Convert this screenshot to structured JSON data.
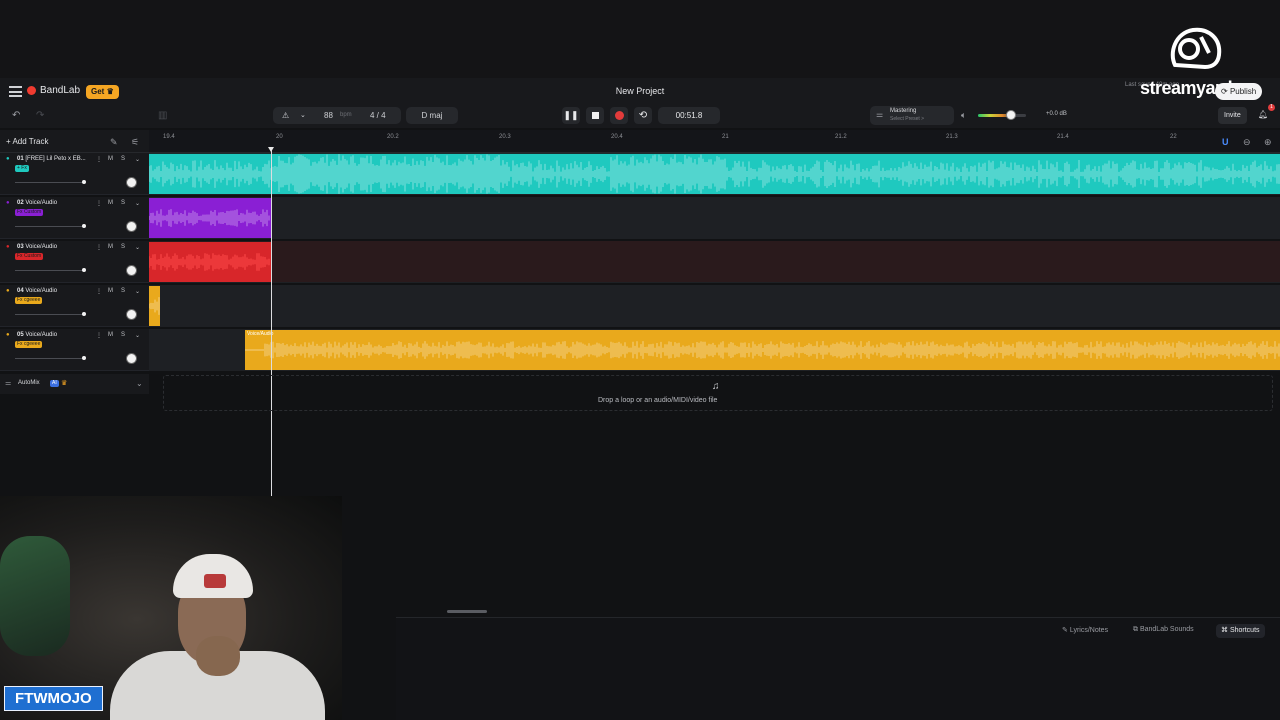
{
  "app": {
    "brand": "BandLab",
    "get_label": "Get",
    "project_title": "New Project",
    "last_saved": "Last saved 40m ago",
    "publish_label": "Publish"
  },
  "toolbar": {
    "bpm": "88",
    "bpm_unit": "bpm",
    "time_signature": "4 / 4",
    "key": "D maj",
    "time": "00:51.8",
    "mastering_title": "Mastering",
    "mastering_preset": "Select Preset >",
    "volume_readout": "+0.0 dB",
    "volume_level": 0.62,
    "invite_label": "Invite",
    "notifications_count": "1"
  },
  "timeline": {
    "add_track_label": "Add Track",
    "ruler_ticks": [
      "19.4",
      "20",
      "20.2",
      "20.3",
      "20.4",
      "21",
      "21.2",
      "21.3",
      "21.4",
      "22"
    ]
  },
  "tracks": [
    {
      "number": "01",
      "name": "[FREE] Lil Peto x EB...",
      "fx": "+ Fx",
      "mute": "M",
      "solo": "S",
      "color": "#1fc9bf",
      "clip_label": ""
    },
    {
      "number": "02",
      "name": "Voice/Audio",
      "fx": "Fx Custom",
      "mute": "M",
      "solo": "S",
      "color": "#8a1fd4",
      "clip_label": ""
    },
    {
      "number": "03",
      "name": "Voice/Audio",
      "fx": "Fx Custom",
      "mute": "M",
      "solo": "S",
      "color": "#d8262a",
      "clip_label": ""
    },
    {
      "number": "04",
      "name": "Voice/Audio",
      "fx": "Fx cgeeee",
      "mute": "M",
      "solo": "S",
      "color": "#e9a91c",
      "clip_label": ""
    },
    {
      "number": "05",
      "name": "Voice/Audio",
      "fx": "Fx cgeeee",
      "mute": "M",
      "solo": "S",
      "color": "#e9a91c",
      "clip_label": "Voice/Audio"
    }
  ],
  "automix": {
    "label": "AutoMix",
    "badge": "AI"
  },
  "dropzone": {
    "text": "Drop a loop or an audio/MIDI/video file"
  },
  "bottom_bar": {
    "lyrics": "Lyrics/Notes",
    "sounds": "BandLab Sounds",
    "shortcuts": "Shortcuts"
  },
  "overlay": {
    "watermark": "streamyard",
    "streamer_name": "FTWMOJO"
  }
}
